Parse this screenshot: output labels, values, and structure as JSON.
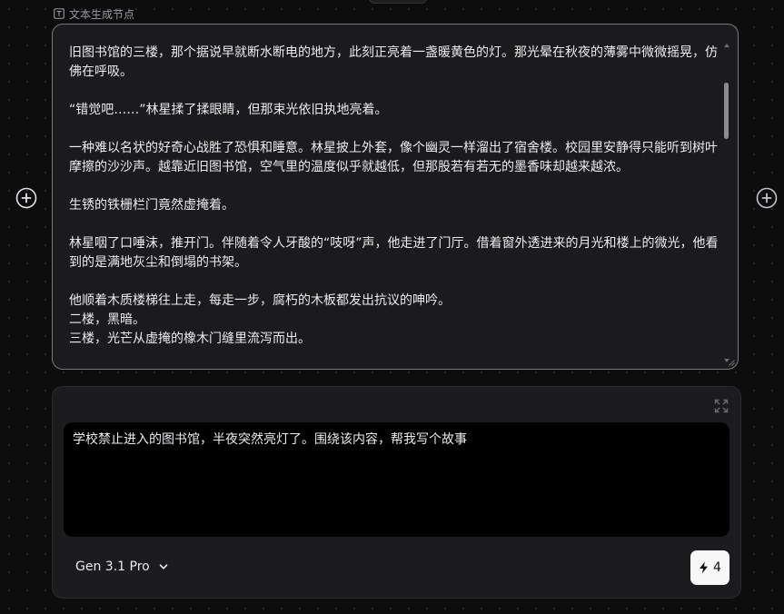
{
  "node": {
    "label": "文本生成节点",
    "label_icon": "text-icon"
  },
  "output": {
    "paragraphs": [
      "旧图书馆的三楼，那个据说早就断水断电的地方，此刻正亮着一盏暖黄色的灯。那光晕在秋夜的薄雾中微微摇晃，仿佛在呼吸。",
      "“错觉吧……”林星揉了揉眼睛，但那束光依旧执地亮着。",
      "一种难以名状的好奇心战胜了恐惧和睡意。林星披上外套，像个幽灵一样溜出了宿舍楼。校园里安静得只能听到树叶摩擦的沙沙声。越靠近旧图书馆，空气里的温度似乎就越低，但那股若有若无的墨香味却越来越浓。",
      "生锈的铁栅栏门竟然虚掩着。",
      "林星咽了口唾沫，推开门。伴随着令人牙酸的“吱呀”声，他走进了门厅。借着窗外透进来的月光和楼上的微光，他看到的是满地灰尘和倒塌的书架。"
    ],
    "lines": [
      "他顺着木质楼梯往上走，每走一步，腐朽的木板都发出抗议的呻吟。",
      "二楼，黑暗。",
      "三楼，光芒从虚掩的橡木门缝里流泻而出。"
    ]
  },
  "prompt": {
    "value": "学校禁止进入的图书馆，半夜突然亮灯了。围绕该内容，帮我写个故事"
  },
  "model": {
    "selected": "Gen 3.1 Pro"
  },
  "generate": {
    "cost": "4"
  },
  "icons": {
    "add_left": "plus-circle-icon",
    "add_right": "plus-circle-icon",
    "expand": "expand-icon",
    "model_chevron": "chevron-down-icon",
    "generate": "lightning-icon"
  }
}
